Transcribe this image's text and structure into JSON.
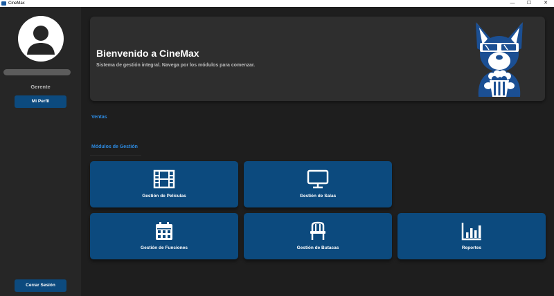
{
  "window": {
    "title": "CineMax",
    "controls": [
      "—",
      "☐",
      "✕"
    ]
  },
  "sidebar": {
    "role": "Gerente",
    "profile_button": "Mi Perfil",
    "logout_button": "Cerrar Sesión"
  },
  "banner": {
    "title": "Bienvenido a CineMax",
    "subtitle": "Sistema de gestión integral. Navega por los módulos para comenzar."
  },
  "sections": {
    "ventas": "Ventas",
    "gestion": "Módulos de Gestión"
  },
  "modules": [
    {
      "label": "Gestión de Películas",
      "icon": "film-icon"
    },
    {
      "label": "Gestión de Salas",
      "icon": "monitor-icon"
    },
    {
      "label": "Gestión de Funciones",
      "icon": "calendar-icon"
    },
    {
      "label": "Gestión de Butacas",
      "icon": "chair-icon"
    },
    {
      "label": "Reportes",
      "icon": "bar-chart-icon"
    }
  ],
  "colors": {
    "accent": "#0c4a7e",
    "section_text": "#2d8ae0",
    "background": "#1e1e1e",
    "sidebar": "#262626",
    "banner": "#2e2e2e"
  }
}
